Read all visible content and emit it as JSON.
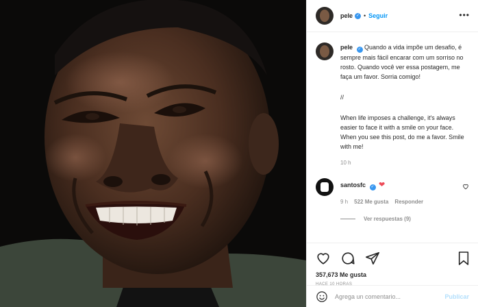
{
  "post": {
    "username": "pele",
    "follow_label": "Seguir",
    "separator": "•",
    "more_label": "•••",
    "verified_mark": "✓"
  },
  "caption": {
    "username": "pele",
    "text_pt": "Quando a vida impõe um desafio, é sempre mais fácil encarar com um sorriso no rosto. Quando você ver essa postagem, me faça um favor. Sorria comigo!",
    "divider": "//",
    "text_en": "When life imposes a challenge, it's always easier to face it with a smile on your face. When you see this post, do me a favor. Smile with me!",
    "time": "10 h"
  },
  "comment": {
    "username": "santosfc",
    "heart": "❤",
    "time": "9 h",
    "likes": "522 Me gusta",
    "reply_label": "Responder",
    "view_replies": "Ver respuestas (9)"
  },
  "actions": {
    "likes_count": "357,673 Me gusta",
    "time_ago": "HACE 10 HORAS",
    "comment_placeholder": "Agrega un comentario...",
    "publish_label": "Publicar"
  },
  "icons": {
    "like": "heart-icon",
    "comment": "comment-icon",
    "share": "share-icon",
    "save": "bookmark-icon",
    "emoji": "emoji-icon"
  },
  "colors": {
    "link": "#0095f6",
    "verified": "#3897f0",
    "muted": "#8e8e8e",
    "heart": "#ed4956"
  }
}
